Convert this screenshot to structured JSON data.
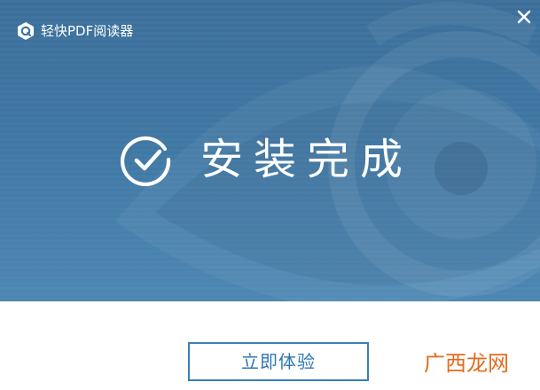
{
  "app": {
    "title": "轻快PDF阅读器",
    "logo_icon": "q-logo-icon",
    "close_icon": "close-icon"
  },
  "hero": {
    "status_icon": "check-circle-icon",
    "headline": "安装完成",
    "background_color": "#3f77a3"
  },
  "footer": {
    "primary_button_label": "立即体验",
    "primary_button_color": "#3b7fb4"
  },
  "watermark": {
    "text": "广西龙网",
    "color": "#e56a1d"
  }
}
